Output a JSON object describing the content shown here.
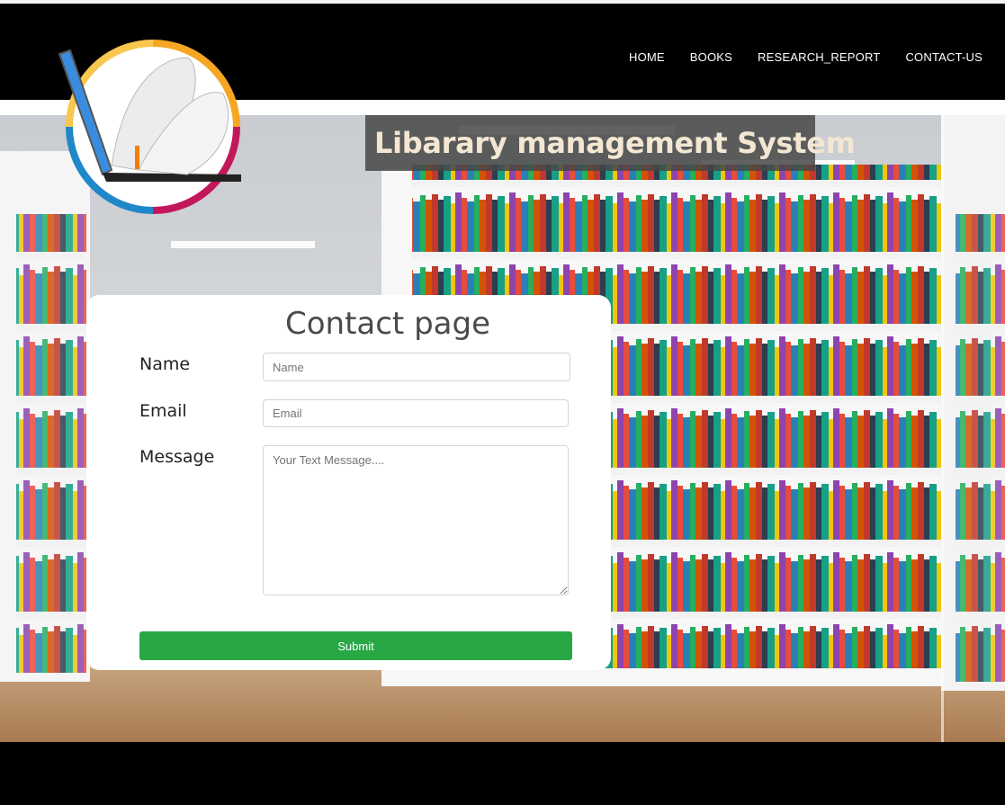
{
  "nav": {
    "items": [
      {
        "label": "HOME"
      },
      {
        "label": "BOOKS"
      },
      {
        "label": "RESEARCH_REPORT"
      },
      {
        "label": "CONTACT-US"
      }
    ]
  },
  "hero": {
    "title": "Libarary management System"
  },
  "contact": {
    "heading": "Contact page",
    "name_label": "Name",
    "name_placeholder": "Name",
    "email_label": "Email",
    "email_placeholder": "Email",
    "message_label": "Message",
    "message_placeholder": "Your Text Message....",
    "submit_label": "Submit"
  },
  "colors": {
    "submit": "#28a745",
    "navbar": "#000000"
  },
  "icons": [
    "library-logo-icon",
    "textarea-resize-icon"
  ]
}
